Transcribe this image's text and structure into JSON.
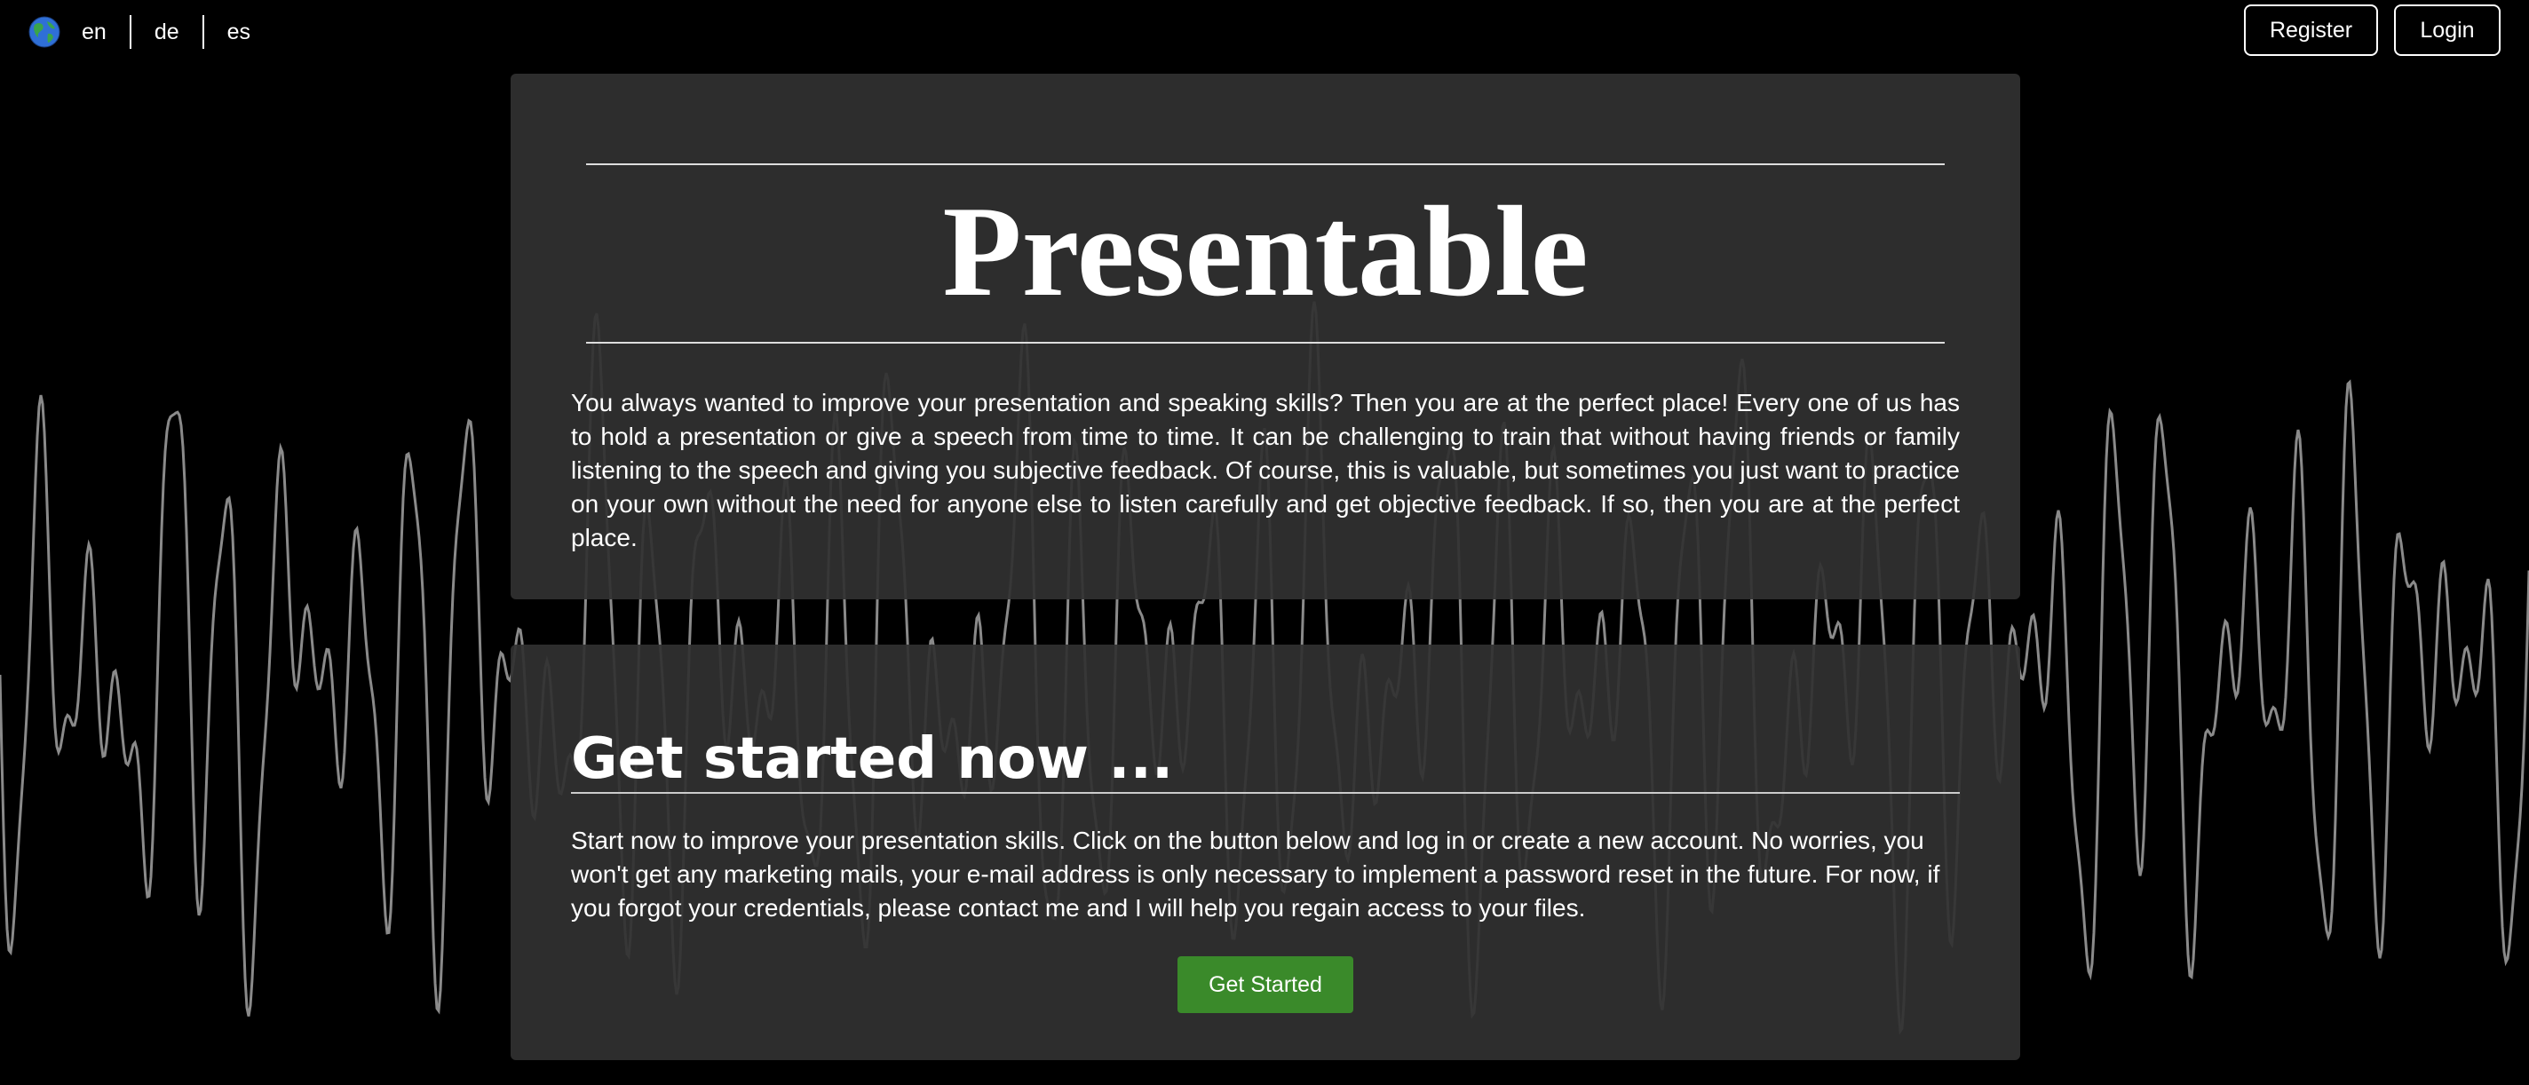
{
  "languages": {
    "globe_icon": "globe-icon",
    "items": [
      {
        "code": "en",
        "label": "en"
      },
      {
        "code": "de",
        "label": "de"
      },
      {
        "code": "es",
        "label": "es"
      }
    ]
  },
  "auth": {
    "register_label": "Register",
    "login_label": "Login"
  },
  "hero": {
    "title": "Presentable",
    "intro": "You always wanted to improve your presentation and speaking skills? Then you are at the perfect place! Every one of us has to hold a presentation or give a speech from time to time. It can be challenging to train that without having friends or family listening to the speech and giving you subjective feedback. Of course, this is valuable, but sometimes you just want to practice on your own without the need for anyone else to listen carefully and get objective feedback. If so, then you are at the perfect place."
  },
  "get_started": {
    "heading": "Get started now ...",
    "text": "Start now to improve your presentation skills. Click on the button below and log in or create a new account. No worries, you won't get any marketing mails, your e-mail address is only necessary to implement a password reset in the future. For now, if you forgot your credentials, please contact me and I will help you regain access to your files.",
    "button_label": "Get Started"
  },
  "colors": {
    "background": "#000000",
    "card": "#303030",
    "accent_button": "#3a8a2a",
    "wave_line": "#8a8a8a"
  }
}
